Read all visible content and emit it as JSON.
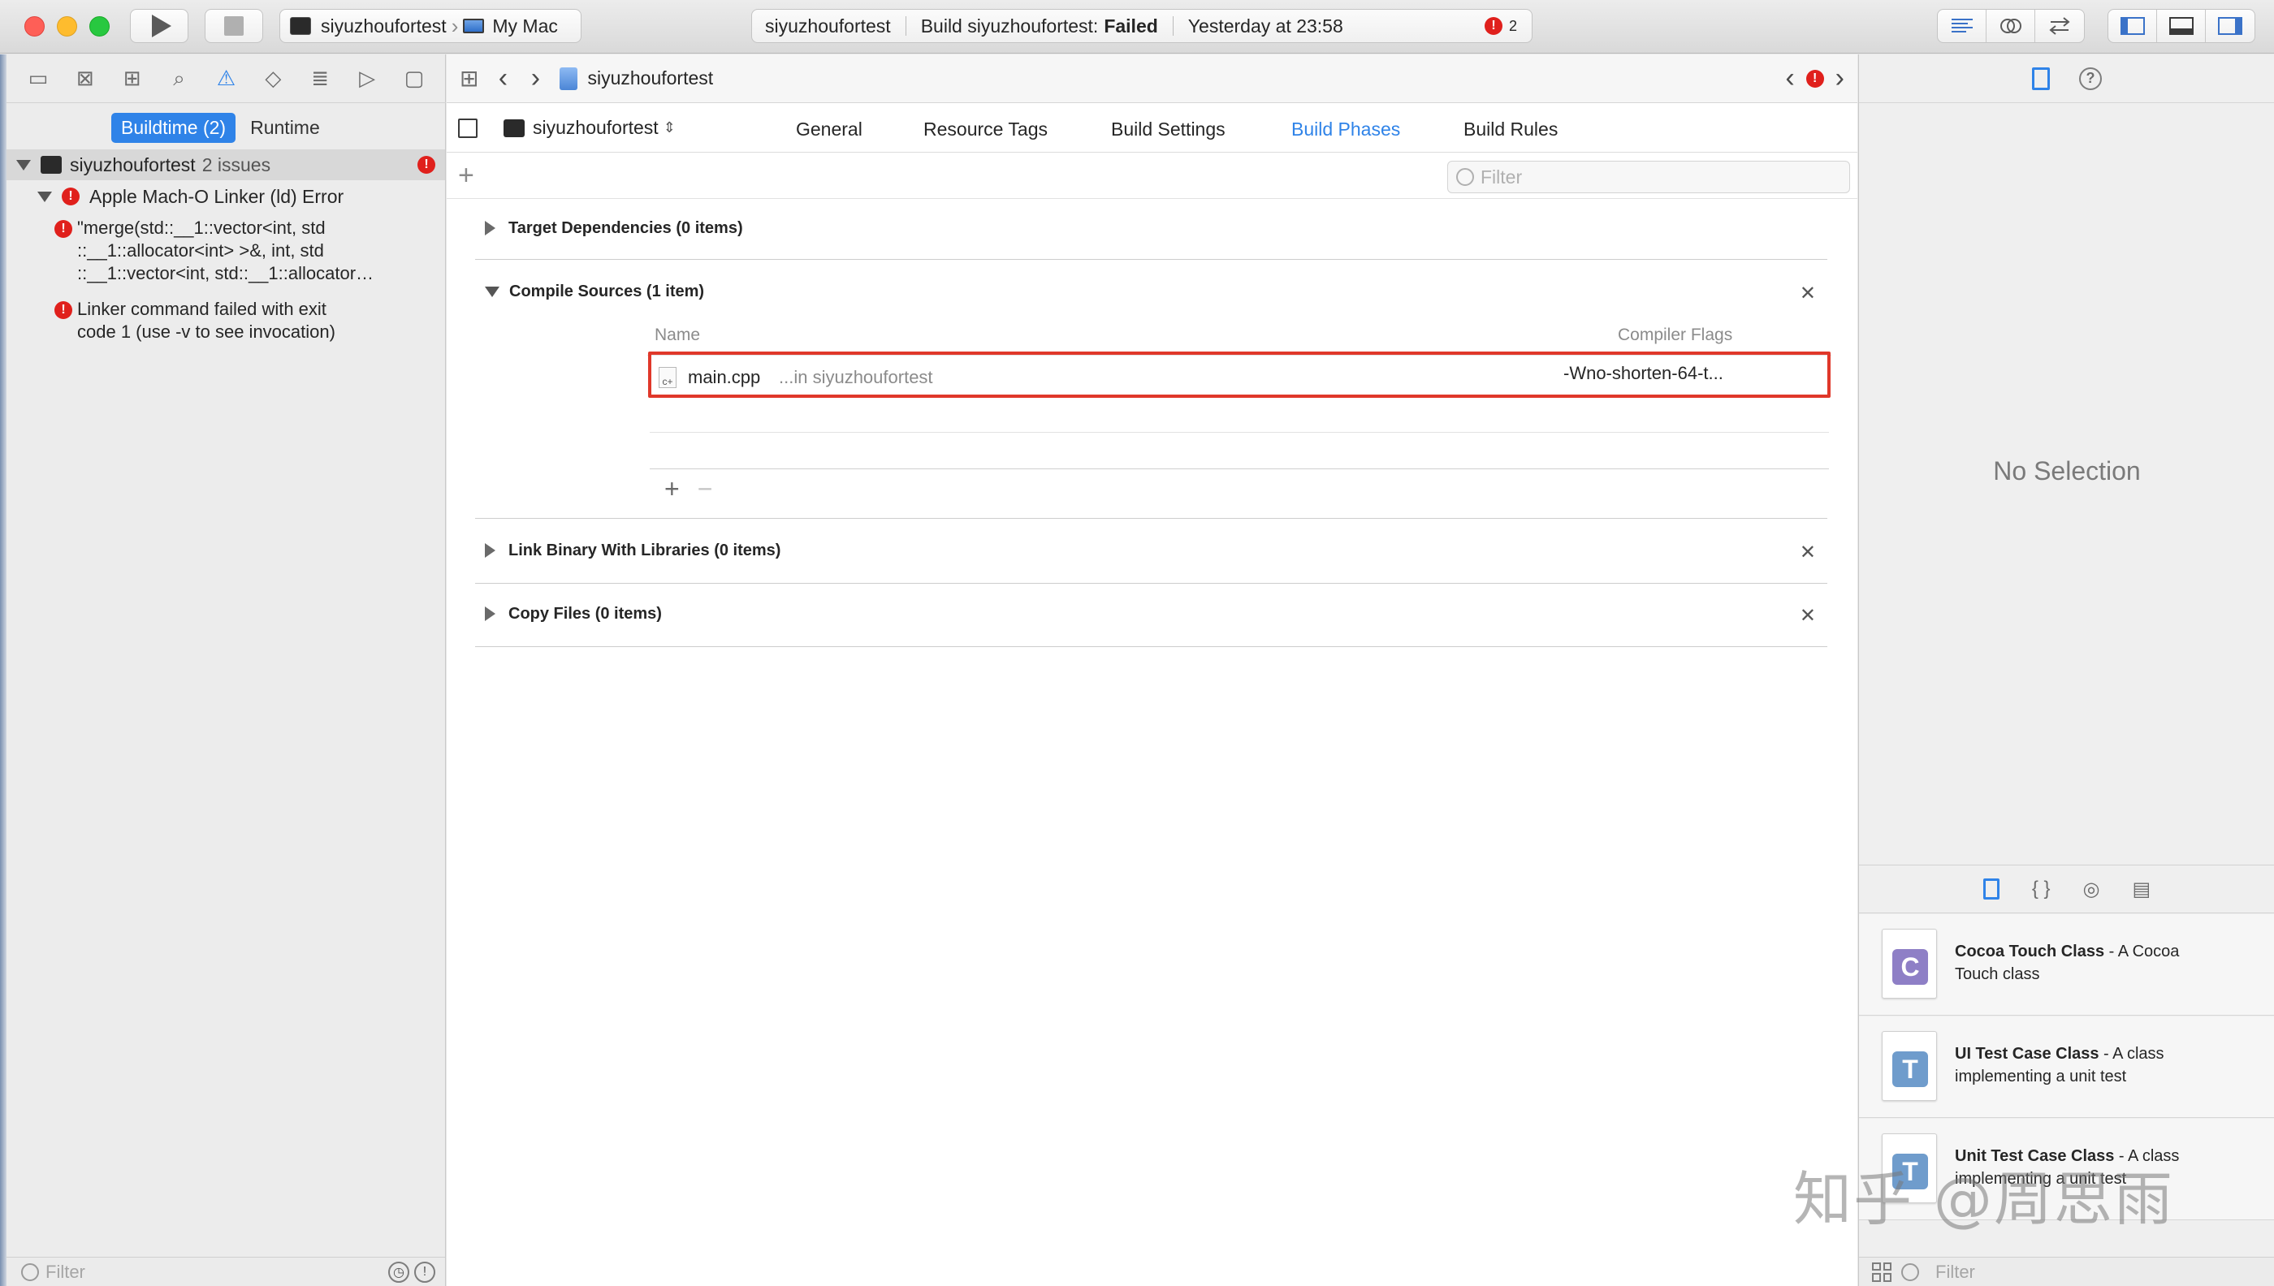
{
  "toolbar": {
    "scheme_target": "siyuzhoufortest",
    "scheme_device": "My Mac",
    "activity_project": "siyuzhoufortest",
    "activity_status_prefix": "Build siyuzhoufortest:",
    "activity_status_value": "Failed",
    "activity_time": "Yesterday at 23:58",
    "error_count": "2"
  },
  "navigator": {
    "scope_buildtime": "Buildtime (2)",
    "scope_runtime": "Runtime",
    "project_name": "siyuzhoufortest",
    "project_issues": "2 issues",
    "group_title": "Apple Mach-O Linker (ld) Error",
    "issues": [
      {
        "line1": "\"merge(std::__1::vector<int, std",
        "line2": "::__1::allocator<int> >&, int, std",
        "line3": "::__1::vector<int, std::__1::allocator…"
      },
      {
        "line1": "Linker command failed with exit",
        "line2": "code 1 (use -v to see invocation)"
      }
    ],
    "filter_placeholder": "Filter"
  },
  "editor": {
    "breadcrumb_project": "siyuzhoufortest",
    "target_name": "siyuzhoufortest",
    "tabs": [
      "General",
      "Resource Tags",
      "Build Settings",
      "Build Phases",
      "Build Rules"
    ],
    "active_tab": "Build Phases",
    "filter_placeholder": "Filter",
    "phases": {
      "target_deps": "Target Dependencies (0 items)",
      "compile_sources": "Compile Sources (1 item)",
      "link_binary": "Link Binary With Libraries (0 items)",
      "copy_files": "Copy Files (0 items)"
    },
    "columns": {
      "name": "Name",
      "flags": "Compiler Flags"
    },
    "source_file": {
      "name": "main.cpp",
      "path": "...in siyuzhoufortest",
      "flags": "-Wno-shorten-64-t...",
      "icon_label": "c+"
    }
  },
  "inspector": {
    "no_selection": "No Selection",
    "library": [
      {
        "title": "Cocoa Touch Class",
        "desc_a": " - A Cocoa",
        "desc_b": "Touch class",
        "glyph": "C",
        "color": "#8e7fc6"
      },
      {
        "title": "UI Test Case Class",
        "desc_a": " - A class",
        "desc_b": "implementing a unit test",
        "glyph": "T",
        "color": "#6f9ccc"
      },
      {
        "title": "Unit Test Case Class",
        "desc_a": " - A class",
        "desc_b": "implementing a unit test",
        "glyph": "T",
        "color": "#6f9ccc"
      }
    ],
    "filter_placeholder": "Filter"
  },
  "watermark": "知乎 @周思雨",
  "colors": {
    "accent": "#2f83e8",
    "error": "#e0201c",
    "highlight_box": "#e0382a"
  }
}
